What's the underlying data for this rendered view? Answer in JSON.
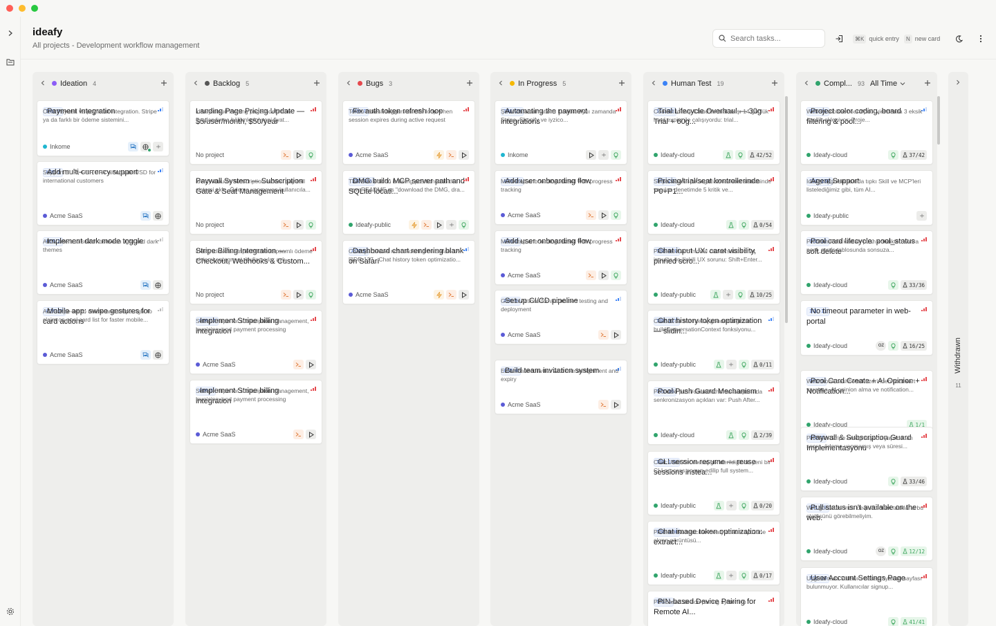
{
  "app": {
    "title": "ideafy",
    "subtitle": "All projects - Development workflow management"
  },
  "header": {
    "search_placeholder": "Search tasks...",
    "quick_entry_key": "⌘K",
    "quick_entry_label": "quick entry",
    "new_card_key": "N",
    "new_card_label": "new card"
  },
  "time_filter": "All Time",
  "withdrawn": {
    "name": "Withdrawn",
    "count": "11"
  },
  "columns": [
    {
      "name": "Ideation",
      "count": "4",
      "dot": "#8b5cf6",
      "cards": [
        {
          "id": "INK-4",
          "title": "Payment Integration",
          "desc": "Özet Paywall ve payment integration. Stripe ya da farklı bir ödeme sistemini...",
          "project": "Inkome",
          "pcolor": "#1fb6d0",
          "prio": "blue",
          "acts": [
            "chat",
            "globe+",
            "dash"
          ]
        },
        {
          "id": "ACM-1",
          "title": "Add multi-currency support",
          "desc": "Support EUR, GBP, JPY alongside USD for international customers",
          "project": "Acme SaaS",
          "pcolor": "#5b5bd6",
          "prio": "blue",
          "acts": [
            "chat",
            "globe"
          ]
        },
        {
          "id": "ACM-2",
          "title": "Implement dark mode toggle",
          "desc": "Allow users to switch between light and dark themes",
          "project": "Acme SaaS",
          "pcolor": "#5b5bd6",
          "prio": "gray",
          "acts": [
            "chat",
            "globe"
          ]
        },
        {
          "id": "ACM-17",
          "title": "Mobile app: swipe gestures for card actions",
          "desc": "Add swipe-left to delete and swipe-right to claim on pool card list for faster mobile...",
          "project": "Acme SaaS",
          "pcolor": "#5b5bd6",
          "prio": "gray",
          "acts": [
            "chat",
            "globe"
          ]
        }
      ]
    },
    {
      "name": "Backlog",
      "count": "5",
      "dot": "#555555",
      "cards": [
        {
          "id": "",
          "title": "Landing Page Pricing Update — $5/user/month, $50/year",
          "desc": "ideafy-cloud landing page'indeki tüm fiyatlandırma bölümlerini yeni fiyat...",
          "project": "No project",
          "pcolor": "",
          "prio": "red",
          "acts": [
            "term",
            "play",
            "bulb"
          ]
        },
        {
          "id": "",
          "title": "Paywall System — Subscription Gate & Seat Management",
          "desc": "ideafy-cloud's subscription tabanlı paywall sistemi ekle. Ödeme yapmayan kullanıcıla...",
          "project": "No project",
          "pcolor": "",
          "prio": "red",
          "acts": [
            "term",
            "play",
            "bulb"
          ]
        },
        {
          "id": "",
          "title": "Stripe Billing Integration — Checkout, Webhooks & Custom...",
          "desc": "ideafy-cloud'a Stripe ile tam kapsamlı ödeme sistemi entegre et. Kullanıcılar aylı...",
          "project": "No project",
          "pcolor": "",
          "prio": "red",
          "acts": [
            "term",
            "play",
            "bulb"
          ]
        },
        {
          "id": "ACM-15",
          "title": "Implement Stripe billing integration",
          "desc": "Set up Stripe for subscription management, invoicing, and payment processing",
          "project": "Acme SaaS",
          "pcolor": "#5b5bd6",
          "prio": "red",
          "acts": [
            "term",
            "play"
          ]
        },
        {
          "id": "ACM-3",
          "title": "Implement Stripe billing integration",
          "desc": "Set up Stripe for subscription management, invoicing, and payment processing",
          "project": "Acme SaaS",
          "pcolor": "#5b5bd6",
          "prio": "red",
          "acts": [
            "term",
            "play"
          ]
        }
      ]
    },
    {
      "name": "Bugs",
      "count": "3",
      "dot": "#e5484d",
      "cards": [
        {
          "id": "ACM-7",
          "title": "Fix auth token refresh loop",
          "desc": "Token refresh triggers infinite loop when session expires during active request",
          "project": "Acme SaaS",
          "pcolor": "#5b5bd6",
          "prio": "red",
          "acts": [
            "zap",
            "term",
            "play"
          ]
        },
        {
          "id": "IDE-143",
          "title": "DMG build: MCP server path and SQLite locati...",
          "desc": "The Solo edition is being positioned in the new README as \"download the DMG, dra...",
          "project": "Ideafy-public",
          "pcolor": "#30a46c",
          "prio": "red",
          "acts": [
            "zap",
            "term",
            "play",
            "dash",
            "bulb"
          ]
        },
        {
          "id": "ACM-8",
          "title": "Dashboard chart rendering blank on Safari",
          "desc": "Chart.js canvas not rendering on Safari 17+ [[IDE-137 · Chat history token optimizatio...",
          "project": "Acme SaaS",
          "pcolor": "#5b5bd6",
          "prio": "blue",
          "acts": [
            "zap",
            "term",
            "play"
          ]
        }
      ]
    },
    {
      "name": "In Progress",
      "count": "5",
      "dot": "#f5b800",
      "cards": [
        {
          "id": "INK-28",
          "title": "Automating the payment integrations",
          "desc": "Şu anda automation'ı kurduk. Aynı zamanda Stripe, Shopify ve iyzico...",
          "project": "Inkome",
          "pcolor": "#1fb6d0",
          "prio": "red",
          "acts": [
            "play",
            "dash",
            "bulb"
          ]
        },
        {
          "id": "ACM-16",
          "title": "Add user onboarding flow",
          "desc": "Multi-step onboarding wizard with progress tracking",
          "project": "Acme SaaS",
          "pcolor": "#5b5bd6",
          "prio": "red",
          "acts": [
            "term",
            "play",
            "bulb"
          ]
        },
        {
          "id": "ACM-5",
          "title": "Add user onboarding flow",
          "desc": "Multi-step onboarding wizard with progress tracking",
          "project": "Acme SaaS",
          "pcolor": "#5b5bd6",
          "prio": "red",
          "acts": [
            "term",
            "play",
            "bulb"
          ]
        },
        {
          "id": "ACM-6",
          "title": "Set up CI/CD pipeline",
          "desc": "GitHub Actions for automated testing and deployment",
          "project": "Acme SaaS",
          "pcolor": "#5b5bd6",
          "prio": "blue",
          "acts": [
            "term",
            "play"
          ]
        },
        {
          "id": "ACM-4",
          "title": "Build team invitation system",
          "desc": "Email-based invites with role assignment and expiry",
          "project": "Acme SaaS",
          "pcolor": "#5b5bd6",
          "prio": "blue",
          "acts": [
            "term",
            "play"
          ]
        }
      ]
    },
    {
      "name": "Human Test",
      "count": "19",
      "dot": "#3b82f6",
      "cards": [
        {
          "id": "ICL-23",
          "title": "Trial Lifecycle Overhaul — 30g Trial + 60g...",
          "desc": "Context Ideafy Cloud'un trial akışı 14 günlük hard expire ile çalışıyordu: trial...",
          "project": "Ideafy-cloud",
          "pcolor": "#30a46c",
          "prio": "red",
          "acts": [
            "flask",
            "bulb"
          ],
          "prog": "42/52"
        },
        {
          "id": "ICL-22",
          "title": "Pricing/trial/seat kontrollerinde P0+P1...",
          "desc": "Stripe tabanlı pricing/trial/member sisteminde yapılan denetimde 5 kritik ve...",
          "project": "Ideafy-cloud",
          "pcolor": "#30a46c",
          "prio": "red",
          "acts": [
            "flask",
            "bulb"
          ],
          "prog": "0/54"
        },
        {
          "id": "IDE-141",
          "title": "Chat input UX: caret visibility, pinned scro...",
          "desc": "Problem Card modal conversation chat input'ta üç ilişkili UX sorunu: Shift+Enter...",
          "project": "Ideafy-public",
          "pcolor": "#30a46c",
          "prio": "red",
          "acts": [
            "flask",
            "dash",
            "bulb"
          ],
          "prog": "10/25"
        },
        {
          "id": "IDE-137",
          "title": "Chat history token optimization — slidin...",
          "desc": "Chat UI'da her mesaj gönderildiğinde buildConversationContext fonksiyonu...",
          "project": "Ideafy-public",
          "pcolor": "#30a46c",
          "prio": "blue",
          "acts": [
            "flask",
            "dash",
            "bulb"
          ],
          "prog": "0/11"
        },
        {
          "id": "ICL-16",
          "title": "Pool Push Guard Mechanism",
          "desc": "Pool'daki push/claim/withdraw akışlarında senkronizasyon açıkları var: Push After...",
          "project": "Ideafy-cloud",
          "pcolor": "#30a46c",
          "prio": "red",
          "acts": [
            "flask",
            "bulb"
          ],
          "prog": "2/39"
        },
        {
          "id": "IDE-139",
          "title": "CLI session resume — reuse sessions instea...",
          "desc": "Chat UI'da her mesaj gönderildiğinde yeni bir CLI process spawn edilip full system...",
          "project": "Ideafy-public",
          "pcolor": "#30a46c",
          "prio": "red",
          "acts": [
            "flask",
            "dash",
            "bulb"
          ],
          "prog": "0/20"
        },
        {
          "id": "IDE-138",
          "title": "Chat image token optimization: extract...",
          "desc": "Problem Kullanıcılar Ideafy chat arayüzüne ekran görüntüsü...",
          "project": "Ideafy-public",
          "pcolor": "#30a46c",
          "prio": "red",
          "acts": [
            "flask",
            "dash",
            "bulb"
          ],
          "prog": "0/17"
        },
        {
          "id": "ICL-1",
          "title": "PIN-based Device Pairing for Remote AI...",
          "desc": "PIN-based device pairing system to",
          "project": "",
          "pcolor": "",
          "prio": "red",
          "acts": []
        }
      ]
    },
    {
      "name": "Compl...",
      "count": "93",
      "dot": "#30a46c",
      "cards": [
        {
          "id": "ICL-21",
          "title": "Project color coding, board filtering & pool...",
          "desc": "Web ve mobile board/pool view'larda 3 eksik özellik ekleniyor: Proje...",
          "project": "Ideafy-cloud",
          "pcolor": "#30a46c",
          "prio": "blue",
          "acts": [
            "bulb"
          ],
          "prog": "37/42"
        },
        {
          "id": "IDE-136",
          "title": "Agent Support",
          "desc": "Ideafy uygulamasında tıpkı Skill ve MCP'leri listelediğimiz gibi, tüm AI...",
          "project": "Ideafy-public",
          "pcolor": "#30a46c",
          "prio": "none",
          "acts": [
            "dash"
          ]
        },
        {
          "id": "ICL-12",
          "title": "Pool card lifecycle: pool_status soft delete",
          "desc": "Problem Pool kartları push edildikten sonra pool_cards tablosunda sonsuza...",
          "project": "Ideafy-cloud",
          "pcolor": "#30a46c",
          "prio": "red",
          "acts": [
            "bulb"
          ],
          "prog": "33/36"
        },
        {
          "id": "ICL-11",
          "title": "No timeout parameter in web-portal",
          "desc": "",
          "project": "Ideafy-cloud",
          "pcolor": "#30a46c",
          "prio": "red",
          "acts": [
            "oz",
            "bulb"
          ],
          "prog": "16/25"
        },
        {
          "id": "ICL-7",
          "title": "Pool Card Create + AI Opinion + Notification...",
          "desc": "Web/mobil dashboard üzerinden pool kart yaratma, AI opinion alma ve notification...",
          "project": "Ideafy-cloud",
          "pcolor": "#30a46c",
          "prio": "red",
          "acts": [],
          "prog": "1/1",
          "pgreen": true
        },
        {
          "id": "ICL-5",
          "title": "Paywall & Subscription Guard Implementasyonu",
          "desc": "Problem Stripe entegrasyonu yapıldıktan sonra, ödeme yapmamış veya süresi...",
          "project": "Ideafy-cloud",
          "pcolor": "#30a46c",
          "prio": "red",
          "acts": [
            "bulb"
          ],
          "prog": "33/46"
        },
        {
          "id": "ICL-10",
          "title": "Pull status isn't available on the web.",
          "desc": "Wrb görünümünde de pull edilen taskların bu statüsünü görebilmeliyim.",
          "project": "Ideafy-cloud",
          "pcolor": "#30a46c",
          "prio": "red",
          "acts": [
            "oz",
            "bulb"
          ],
          "prog": "12/12",
          "pgreen": true
        },
        {
          "id": "ICL-14",
          "title": "User Account Settings Page",
          "desc": "Uygulamada kullanıcı hesap ayarları sayfası bulunmuyor. Kullanıcılar signup...",
          "project": "Ideafy-cloud",
          "pcolor": "#30a46c",
          "prio": "red",
          "acts": [
            "bulb"
          ],
          "prog": "41/41",
          "pgreen": true
        }
      ]
    }
  ]
}
